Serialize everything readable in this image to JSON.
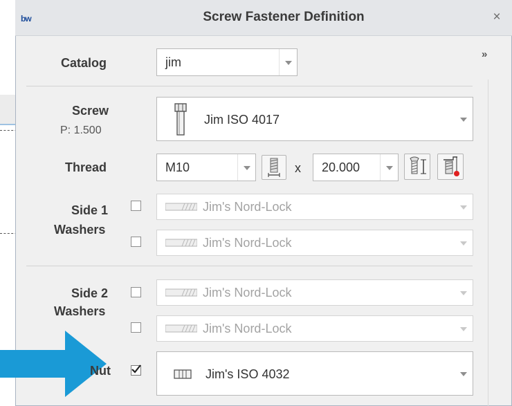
{
  "dialog": {
    "logo": "bw",
    "title": "Screw Fastener Definition",
    "close": "×",
    "expand": "»"
  },
  "catalog": {
    "label": "Catalog",
    "value": "jim"
  },
  "screw": {
    "label": "Screw",
    "pitch": "P: 1.500",
    "value": "Jim ISO 4017"
  },
  "thread": {
    "label": "Thread",
    "size": "M10",
    "times": "x",
    "length": "20.000"
  },
  "side1": {
    "label_line1": "Side 1",
    "label_line2": "Washers",
    "washers": [
      {
        "value": "Jim's Nord-Lock",
        "checked": false
      },
      {
        "value": "Jim's Nord-Lock",
        "checked": false
      }
    ]
  },
  "side2": {
    "label_line1": "Side 2",
    "label_line2": "Washers",
    "washers": [
      {
        "value": "Jim's Nord-Lock",
        "checked": false
      },
      {
        "value": "Jim's Nord-Lock",
        "checked": false
      }
    ]
  },
  "nut": {
    "label": "Nut",
    "checked": true,
    "value": "Jim's ISO 4032"
  },
  "colors": {
    "accent_arrow": "#1a9ad6",
    "nut_dot": "#e02020"
  }
}
